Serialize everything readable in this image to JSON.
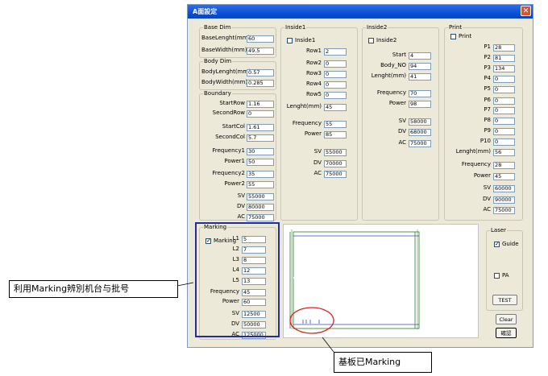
{
  "window": {
    "title": "A面設定",
    "close": "✕"
  },
  "base_dim": {
    "title": "Base Dim",
    "rows": [
      {
        "label": "BaseLenght(mm)",
        "value": "60"
      },
      {
        "label": "BaseWidth(mm)",
        "value": "49.5"
      }
    ]
  },
  "body_dim": {
    "title": "Body Dim",
    "rows": [
      {
        "label": "BodyLenght(mm)",
        "value": "0.57"
      },
      {
        "label": "BodyWidth(mm)",
        "value": "0.285"
      }
    ]
  },
  "boundary": {
    "title": "Boundary",
    "rows": [
      {
        "label": "StartRow",
        "value": "1.16"
      },
      {
        "label": "SecondRow",
        "value": "0"
      },
      {
        "label": "StartCol",
        "value": "1.61"
      },
      {
        "label": "SecondCol",
        "value": "5.7"
      },
      {
        "label": "Frequency1",
        "value": "30"
      },
      {
        "label": "Power1",
        "value": "50"
      },
      {
        "label": "Frequency2",
        "value": "35"
      },
      {
        "label": "Power2",
        "value": "55"
      },
      {
        "label": "SV",
        "value": "55000"
      },
      {
        "label": "DV",
        "value": "80000"
      },
      {
        "label": "AC",
        "value": "75000"
      }
    ]
  },
  "inside1": {
    "title": "Inside1",
    "checkbox": "Inside1",
    "checked": false,
    "rows": [
      {
        "label": "Row1",
        "value": "2"
      },
      {
        "label": "Row2",
        "value": "0"
      },
      {
        "label": "Row3",
        "value": "0"
      },
      {
        "label": "Row4",
        "value": "0"
      },
      {
        "label": "Row5",
        "value": "0"
      },
      {
        "label": "Lenght(mm)",
        "value": "45"
      },
      {
        "label": "Frequency",
        "value": "55"
      },
      {
        "label": "Power",
        "value": "85"
      },
      {
        "label": "SV",
        "value": "55000"
      },
      {
        "label": "DV",
        "value": "70000"
      },
      {
        "label": "AC",
        "value": "75000"
      }
    ]
  },
  "inside2": {
    "title": "Inside2",
    "checkbox": "Inside2",
    "checked": false,
    "rows": [
      {
        "label": "Start",
        "value": "4"
      },
      {
        "label": "Body_NO",
        "value": "94"
      },
      {
        "label": "Lenght(mm)",
        "value": "41"
      },
      {
        "label": "Frequency",
        "value": "70"
      },
      {
        "label": "Power",
        "value": "98"
      },
      {
        "label": "SV",
        "value": "58000"
      },
      {
        "label": "DV",
        "value": "68000"
      },
      {
        "label": "AC",
        "value": "75000"
      }
    ]
  },
  "print": {
    "title": "Print",
    "checkbox": "Print",
    "checked": false,
    "rows": [
      {
        "label": "P1",
        "value": "28"
      },
      {
        "label": "P2",
        "value": "81"
      },
      {
        "label": "P3",
        "value": "134"
      },
      {
        "label": "P4",
        "value": "0"
      },
      {
        "label": "P5",
        "value": "0"
      },
      {
        "label": "P6",
        "value": "0"
      },
      {
        "label": "P7",
        "value": "0"
      },
      {
        "label": "P8",
        "value": "0"
      },
      {
        "label": "P9",
        "value": "0"
      },
      {
        "label": "P10",
        "value": "0"
      },
      {
        "label": "Lenght(mm)",
        "value": "56"
      },
      {
        "label": "Frequency",
        "value": "28"
      },
      {
        "label": "Power",
        "value": "45"
      },
      {
        "label": "SV",
        "value": "60000"
      },
      {
        "label": "DV",
        "value": "90000"
      },
      {
        "label": "AC",
        "value": "75000"
      }
    ]
  },
  "marking": {
    "title": "Marking",
    "checkbox": "Marking",
    "checked": true,
    "rows": [
      {
        "label": "L1",
        "value": "5"
      },
      {
        "label": "L2",
        "value": "7"
      },
      {
        "label": "L3",
        "value": "8"
      },
      {
        "label": "L4",
        "value": "12"
      },
      {
        "label": "L5",
        "value": "13"
      },
      {
        "label": "Frequency",
        "value": "45"
      },
      {
        "label": "Power",
        "value": "60"
      },
      {
        "label": "SV",
        "value": "12500"
      },
      {
        "label": "DV",
        "value": "50000"
      },
      {
        "label": "AC",
        "value": "125000"
      }
    ]
  },
  "laser": {
    "title": "Laser",
    "guide_label": "Guide",
    "guide_checked": true,
    "pa_label": "PA",
    "pa_checked": false,
    "test_label": "TEST"
  },
  "buttons": {
    "clear": "Clear",
    "confirm": "確認"
  },
  "annotations": {
    "left": "利用Marking辨別机台与批号",
    "bottom": "基板已Marking"
  },
  "colors": {
    "highlight_box": "#1f2fa0",
    "circle": "#e02020",
    "preview_blue": "#3344cc",
    "preview_green": "#2a7a2a"
  }
}
